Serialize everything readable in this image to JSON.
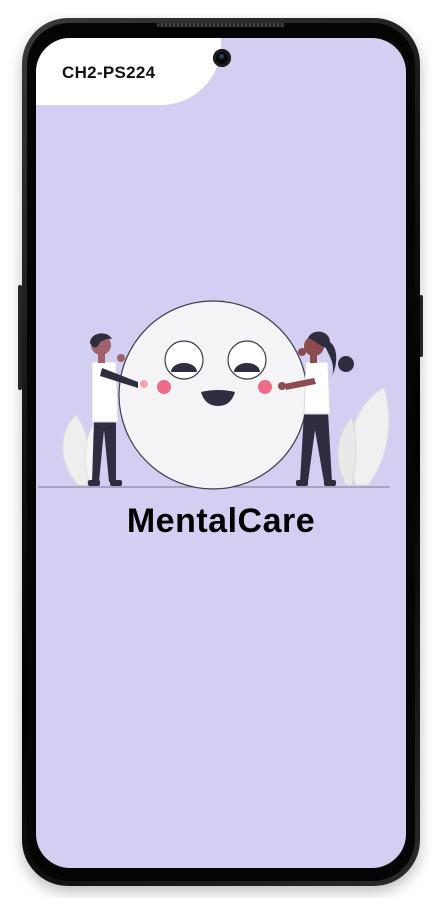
{
  "header": {
    "title": "CH2-PS224"
  },
  "app": {
    "name": "MentalCare"
  },
  "colors": {
    "background": "#d3cff3",
    "header_bg": "#ffffff",
    "face": "#f2f2f5",
    "cheek": "#f06b87",
    "dark": "#2f2e41"
  },
  "icons": {
    "illustration": "mental-health-smiley-illustration",
    "camera": "front-camera"
  }
}
